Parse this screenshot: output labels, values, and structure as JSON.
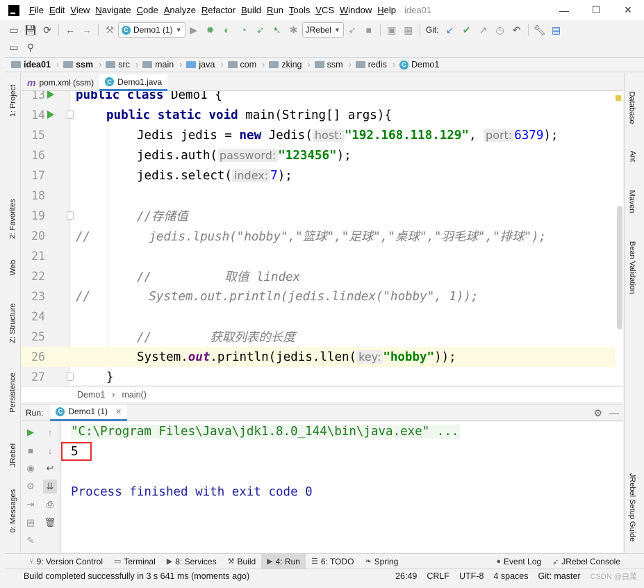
{
  "window": {
    "project_label": "idea01",
    "controls": [
      "—",
      "☐",
      "✕"
    ]
  },
  "menu": [
    "File",
    "Edit",
    "View",
    "Navigate",
    "Code",
    "Analyze",
    "Refactor",
    "Build",
    "Run",
    "Tools",
    "VCS",
    "Window",
    "Help"
  ],
  "toolbar": {
    "run_config": "Demo1 (1)",
    "jrebel_combo": "JRebel",
    "git_label": "Git:"
  },
  "breadcrumbs": [
    "idea01",
    "ssm",
    "src",
    "main",
    "java",
    "com",
    "zking",
    "ssm",
    "redis",
    "Demo1"
  ],
  "editor_tabs": [
    {
      "label": "pom.xml (ssm)"
    },
    {
      "label": "Demo1.java"
    }
  ],
  "left_tool_tabs": [
    "1: Project",
    "2: Favorites",
    "Web",
    "Z: Structure",
    "Persistence",
    "JRebel",
    "0: Messages"
  ],
  "right_tool_tabs": [
    "Database",
    "Ant",
    "Maven",
    "Bean Validation",
    "JRebel Setup Guide"
  ],
  "code": {
    "line_numbers": [
      "13",
      "14",
      "15",
      "16",
      "17",
      "18",
      "19",
      "20",
      "21",
      "22",
      "23",
      "24",
      "25",
      "26",
      "27"
    ],
    "l13": {
      "kw": "public class",
      "rest": " Demo1 {"
    },
    "l14": {
      "kw1": "public static void",
      "rest": " main(String[] args){"
    },
    "l15": {
      "a": "Jedis jedis = ",
      "kw": "new",
      "b": " Jedis(",
      "hint1": "host:",
      "s1": "\"192.168.118.129\"",
      "c": ", ",
      "hint2": "port:",
      "n1": "6379",
      "d": ");"
    },
    "l16": {
      "a": "jedis.auth(",
      "hint": "password:",
      "s": "\"123456\"",
      "b": ");"
    },
    "l17": {
      "a": "jedis.select(",
      "hint": "index:",
      "n": "7",
      "b": ");"
    },
    "l19": "//存储值",
    "l20": "//        jedis.lpush(\"hobby\",\"篮球\",\"足球\",\"桌球\",\"羽毛球\",\"排球\");",
    "l22": "//          取值 lindex",
    "l23": "//        System.out.println(jedis.lindex(\"hobby\", 1));",
    "l25": "//        获取列表的长度",
    "l26": {
      "a": "System.",
      "f": "out",
      "b": ".println(jedis.llen(",
      "hint": "key:",
      "s": "\"hobby\"",
      "c": "));"
    },
    "l27": "}"
  },
  "editor_breadcrumb": [
    "Demo1",
    "main()"
  ],
  "run_panel": {
    "title": "Run:",
    "tab": "Demo1 (1)",
    "command": "\"C:\\Program Files\\Java\\jdk1.8.0_144\\bin\\java.exe\" ...",
    "output": "5",
    "exit": "Process finished with exit code 0"
  },
  "bottom_tabs": [
    {
      "label": "9: Version Control"
    },
    {
      "label": "Terminal"
    },
    {
      "label": "8: Services"
    },
    {
      "label": "Build"
    },
    {
      "label": "4: Run"
    },
    {
      "label": "6: TODO"
    },
    {
      "label": "Spring"
    }
  ],
  "bottom_right_tabs": [
    "Event Log",
    "JRebel Console"
  ],
  "status": {
    "message": "Build completed successfully in 3 s 641 ms (moments ago)",
    "position": "26:49",
    "line_sep": "CRLF",
    "encoding": "UTF-8",
    "indent": "4 spaces",
    "git": "Git: master",
    "watermark": "CSDN @白菜"
  }
}
